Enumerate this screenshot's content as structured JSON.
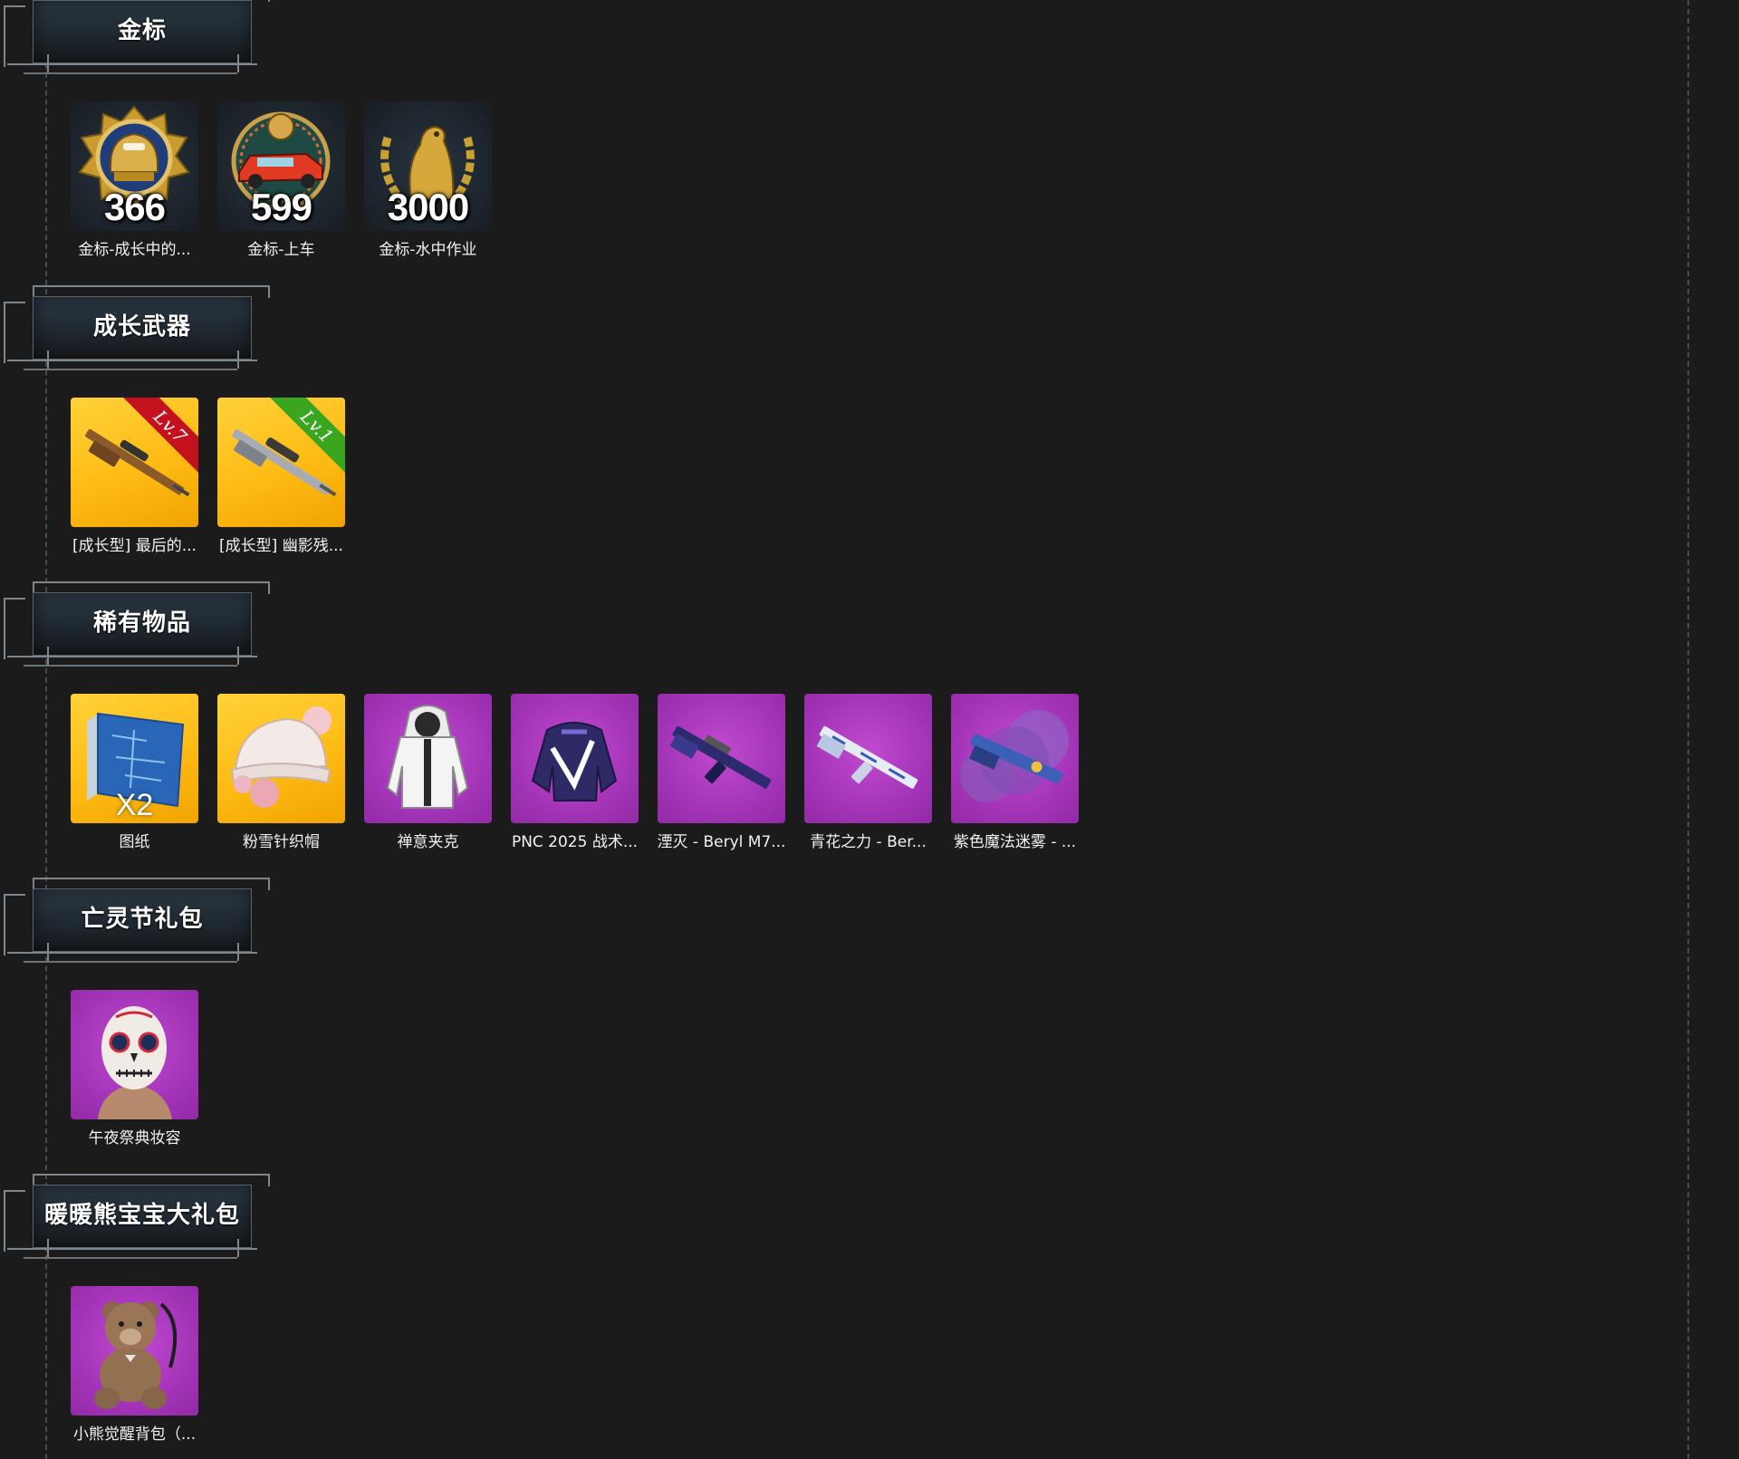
{
  "sections": [
    {
      "title": "金标",
      "items": [
        {
          "name": "金标-成长中的...",
          "count": "366",
          "bg": "dark",
          "icon": "gold-emblem-helmet-icon"
        },
        {
          "name": "金标-上车",
          "count": "599",
          "bg": "dark",
          "icon": "gold-emblem-car-icon"
        },
        {
          "name": "金标-水中作业",
          "count": "3000",
          "bg": "dark",
          "icon": "gold-emblem-seal-icon"
        }
      ]
    },
    {
      "title": "成长武器",
      "items": [
        {
          "name": "[成长型] 最后的...",
          "level": "Lv.7",
          "ribbon": "red",
          "bg": "gold",
          "icon": "sniper-rifle-icon"
        },
        {
          "name": "[成长型] 幽影残...",
          "level": "Lv.1",
          "ribbon": "green",
          "bg": "gold",
          "icon": "sniper-rifle-silver-icon"
        }
      ]
    },
    {
      "title": "稀有物品",
      "items": [
        {
          "name": "图纸",
          "qty": "X2",
          "bg": "gold",
          "icon": "blueprint-icon"
        },
        {
          "name": "粉雪针织帽",
          "bg": "gold",
          "icon": "knit-hat-icon"
        },
        {
          "name": "禅意夹克",
          "bg": "purple",
          "icon": "hooded-jacket-icon"
        },
        {
          "name": "PNC 2025 战术...",
          "bg": "purple",
          "icon": "tactical-top-icon"
        },
        {
          "name": "湮灭 - Beryl M7...",
          "bg": "purple",
          "icon": "assault-rifle-purple-icon"
        },
        {
          "name": "青花之力 - Ber...",
          "bg": "purple",
          "icon": "assault-rifle-porcelain-icon"
        },
        {
          "name": "紫色魔法迷雾 - ...",
          "bg": "purple",
          "icon": "shotgun-mist-icon"
        }
      ]
    },
    {
      "title": "亡灵节礼包",
      "items": [
        {
          "name": "午夜祭典妆容",
          "bg": "purple",
          "icon": "skull-face-paint-icon"
        }
      ]
    },
    {
      "title": "暖暖熊宝宝大礼包",
      "items": [
        {
          "name": "小熊觉醒背包（...",
          "bg": "purple",
          "icon": "teddy-bear-backpack-icon"
        }
      ]
    }
  ]
}
